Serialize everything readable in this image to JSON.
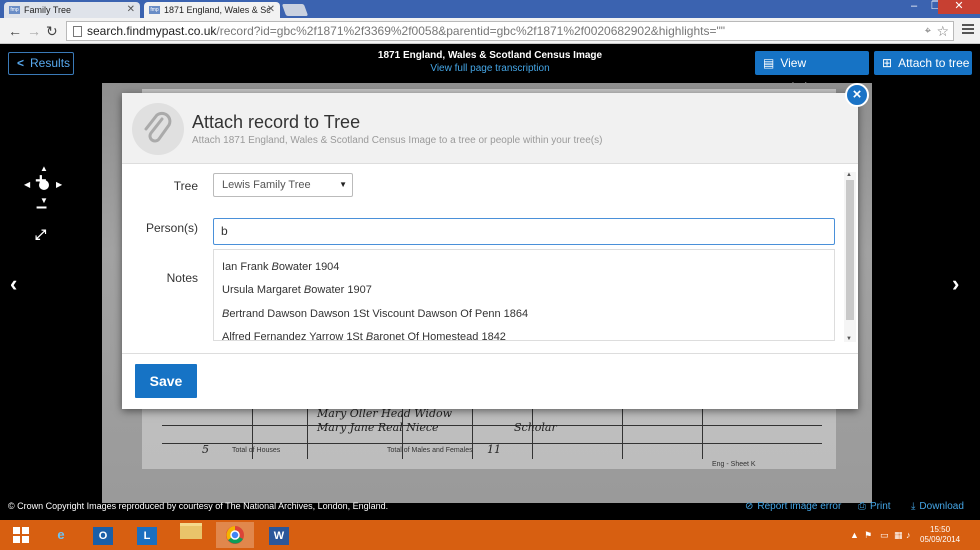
{
  "browser": {
    "tabs": [
      {
        "label": "Family Tree",
        "favicon": "fmp"
      },
      {
        "label": "1871 England, Wales & Sc",
        "favicon": "fmp"
      }
    ],
    "url_main": "search.findmypast.co.uk",
    "url_rest": "/record?id=gbc%2f1871%2f3369%2f0058&parentid=gbc%2f1871%2f0020682902&highlights=\"\""
  },
  "viewer": {
    "results_label": "Results",
    "title": "1871 England, Wales & Scotland Census Image",
    "full_page_link": "View full page transcription",
    "view_transcription_label": "View transcription",
    "attach_label": "Attach to tree",
    "copyright": "© Crown Copyright Images reproduced by courtesy of The National Archives, London, England.",
    "report_label": "Report image error",
    "print_label": "Print",
    "download_label": "Download",
    "scan_text": {
      "r1": "Mary  Oller   Head   Widow",
      "r2": "Mary Jane Real   Niece",
      "r3": "Scholar",
      "r4": "Total of Houses",
      "r5": "Total of Males and Females",
      "r6": "Eng - Sheet K",
      "r7": "5",
      "r8": "11"
    }
  },
  "modal": {
    "title": "Attach record to Tree",
    "subtitle": "Attach 1871 England, Wales & Scotland Census Image to a tree or people within your tree(s)",
    "tree_label": "Tree",
    "tree_value": "Lewis Family Tree",
    "persons_label": "Person(s)",
    "persons_value": "b",
    "notes_label": "Notes",
    "suggestions": [
      {
        "pre": "Ian Frank ",
        "match": "B",
        "post": "owater 1904"
      },
      {
        "pre": "Ursula Margaret ",
        "match": "B",
        "post": "owater 1907"
      },
      {
        "pre": "",
        "match": "B",
        "post": "ertrand Dawson Dawson 1St Viscount Dawson Of Penn 1864"
      },
      {
        "pre": "Alfred Fernandez Yarrow 1St ",
        "match": "B",
        "post": "aronet Of Homestead 1842"
      }
    ],
    "save_label": "Save"
  },
  "taskbar": {
    "time": "15:50",
    "date": "05/09/2014"
  }
}
